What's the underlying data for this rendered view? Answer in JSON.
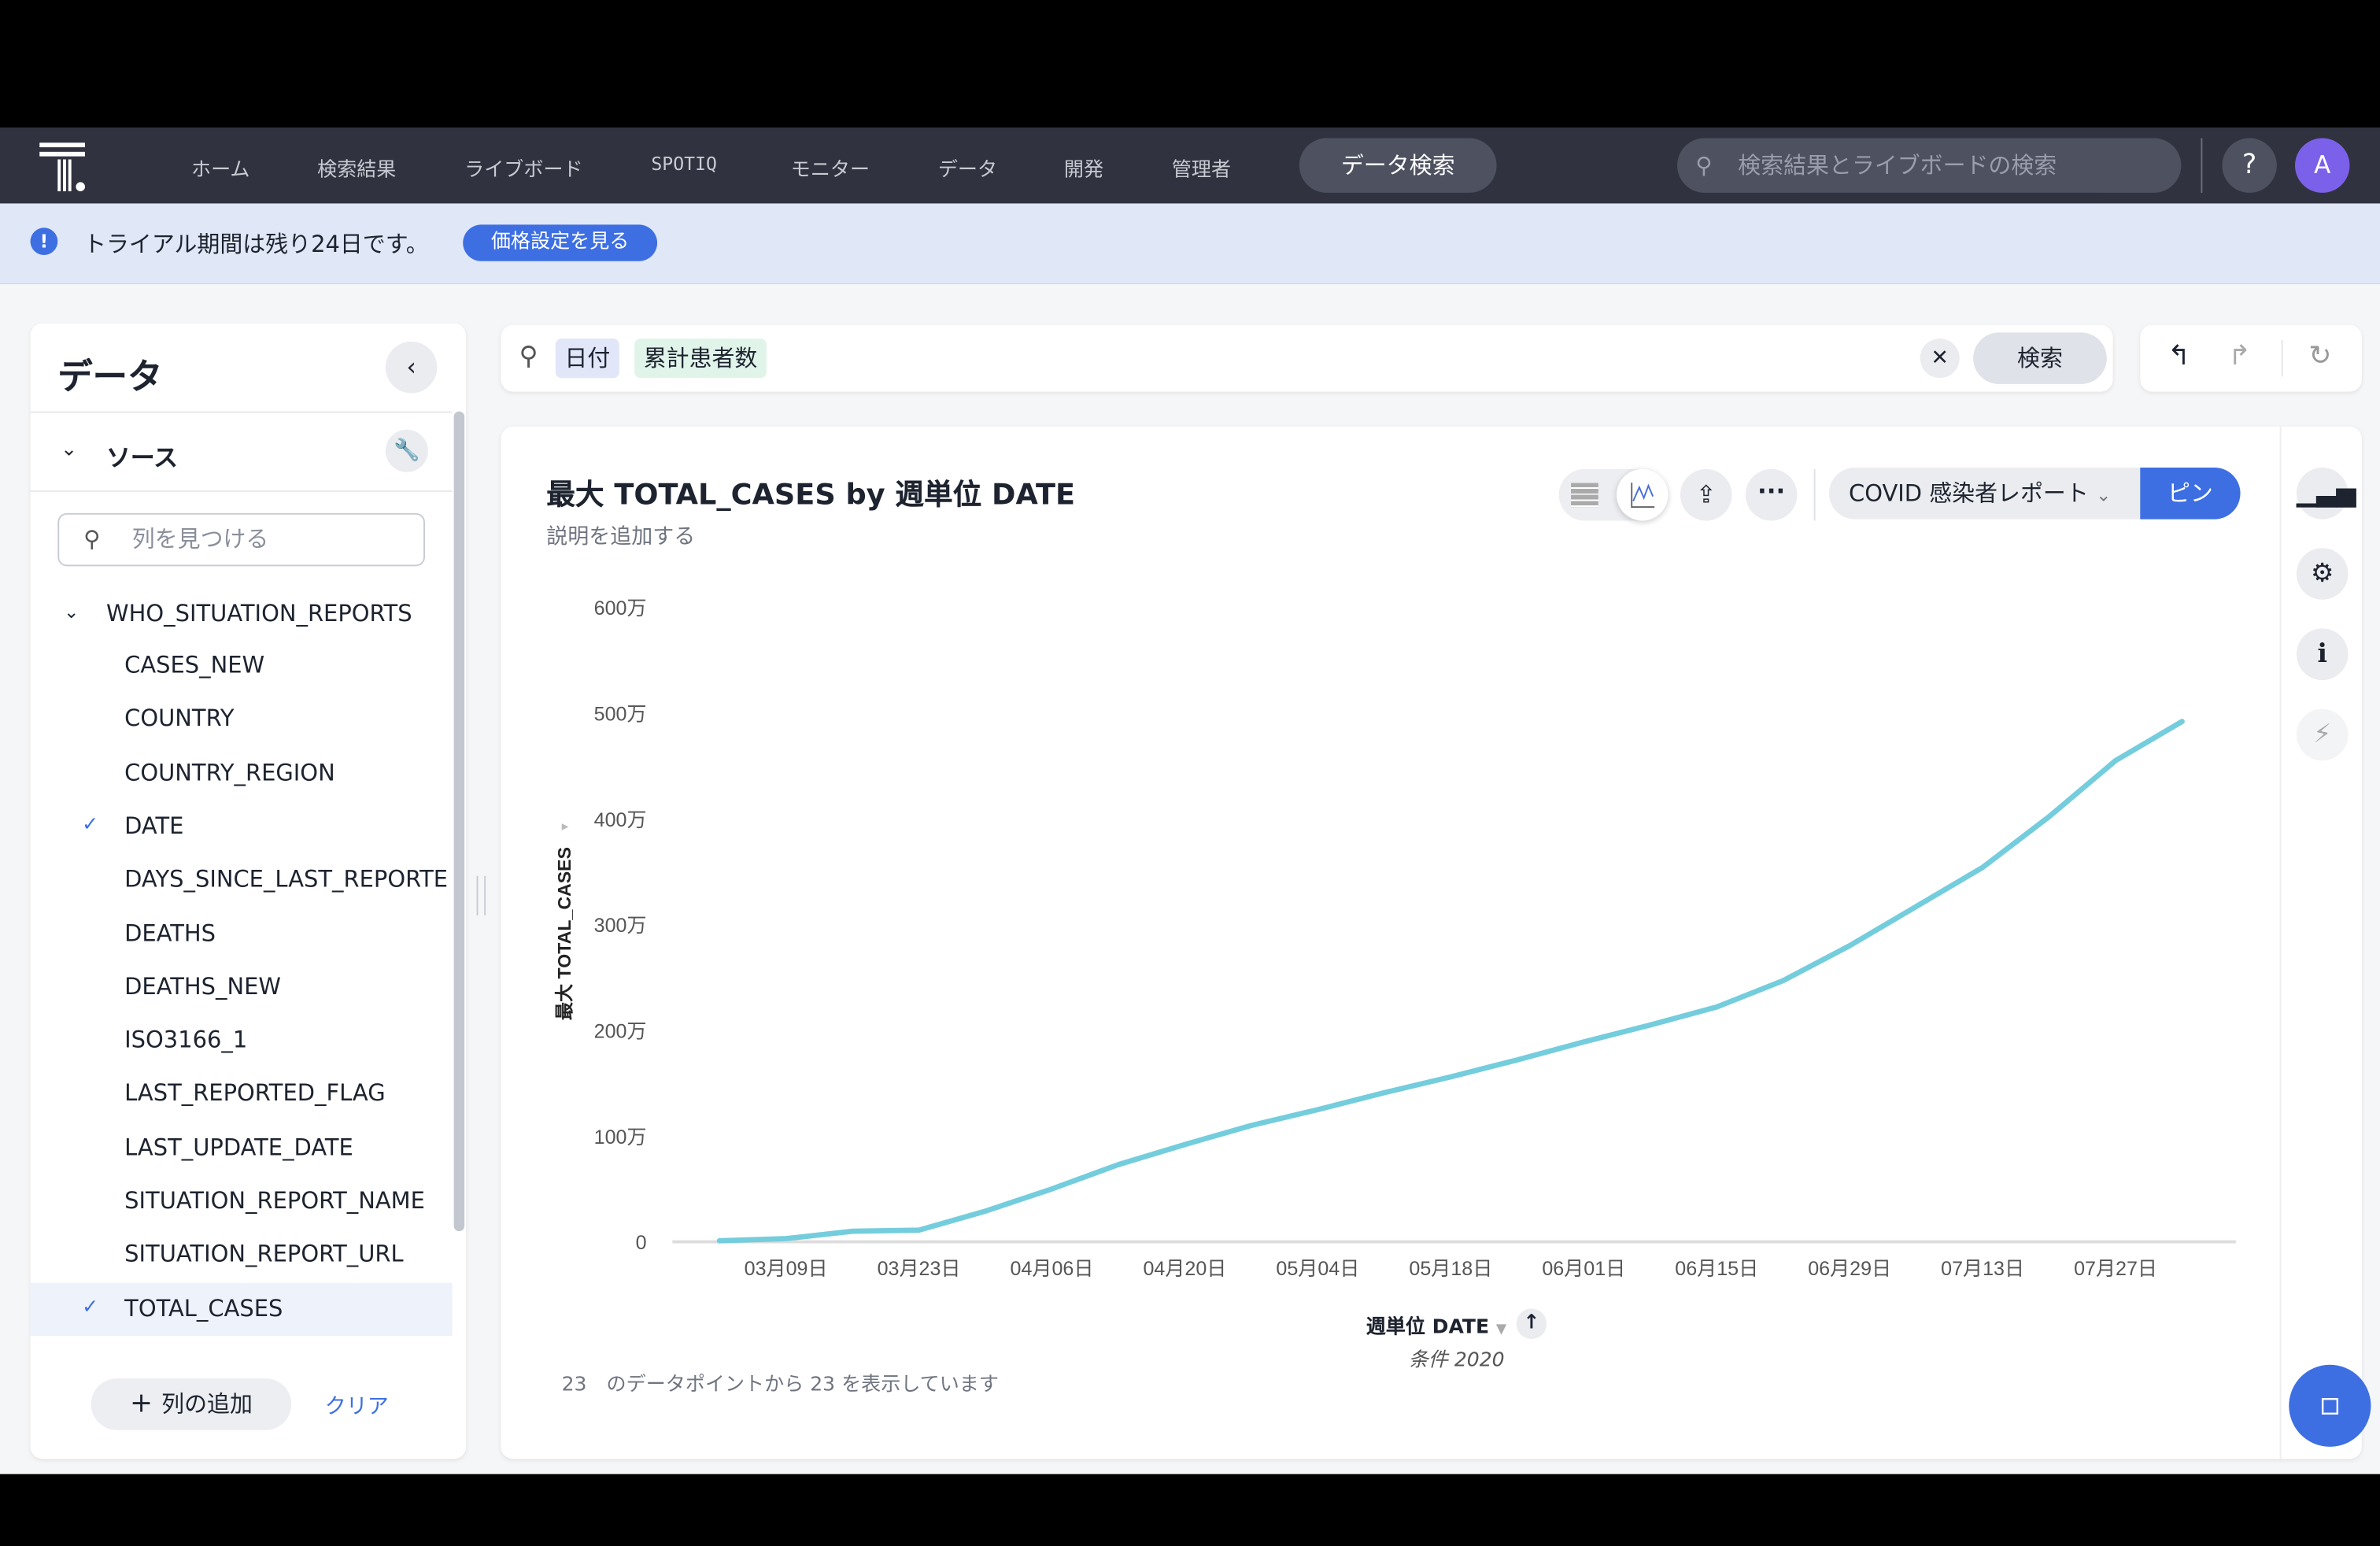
{
  "nav": {
    "items": [
      "ホーム",
      "検索結果",
      "ライブボード",
      "SPOTIQ",
      "モニター",
      "データ",
      "開発",
      "管理者"
    ],
    "data_search": "データ検索",
    "search_placeholder": "検索結果とライブボードの検索",
    "help": "?",
    "avatar": "A"
  },
  "banner": {
    "text": "トライアル期間は残り24日です。",
    "button": "価格設定を見る",
    "icon": "!"
  },
  "sidebar": {
    "title": "データ",
    "section": "ソース",
    "find_placeholder": "列を見つける",
    "table": "WHO_SITUATION_REPORTS",
    "columns": [
      {
        "name": "CASES_NEW",
        "checked": false
      },
      {
        "name": "COUNTRY",
        "checked": false
      },
      {
        "name": "COUNTRY_REGION",
        "checked": false
      },
      {
        "name": "DATE",
        "checked": true
      },
      {
        "name": "DAYS_SINCE_LAST_REPORTE",
        "checked": false
      },
      {
        "name": "DEATHS",
        "checked": false
      },
      {
        "name": "DEATHS_NEW",
        "checked": false
      },
      {
        "name": "ISO3166_1",
        "checked": false
      },
      {
        "name": "LAST_REPORTED_FLAG",
        "checked": false
      },
      {
        "name": "LAST_UPDATE_DATE",
        "checked": false
      },
      {
        "name": "SITUATION_REPORT_NAME",
        "checked": false
      },
      {
        "name": "SITUATION_REPORT_URL",
        "checked": false
      },
      {
        "name": "TOTAL_CASES",
        "checked": true
      }
    ],
    "add_column": "列の追加",
    "clear": "クリア"
  },
  "search": {
    "tokens": [
      "日付",
      "累計患者数"
    ],
    "button": "検索"
  },
  "chart_panel": {
    "title": "最大 TOTAL_CASES by 週単位 DATE",
    "description": "説明を追加する",
    "report": "COVID 感染者レポート",
    "pin": "ピン",
    "x_title": "週単位 DATE",
    "x_filter": "条件 2020",
    "count_text": "23　のデータポイントから 23 を表示しています"
  },
  "colors": {
    "line": "#74cddc",
    "accent": "#3d6fe3",
    "nav": "#30333f"
  },
  "chart_data": {
    "type": "line",
    "title": "最大 TOTAL_CASES by 週単位 DATE",
    "xlabel": "週単位 DATE",
    "ylabel": "最大 TOTAL_CASES",
    "ylim": [
      0,
      6000000
    ],
    "yticks": [
      0,
      1000000,
      2000000,
      3000000,
      4000000,
      5000000,
      6000000
    ],
    "ytick_labels": [
      "0",
      "100万",
      "200万",
      "300万",
      "400万",
      "500万",
      "600万"
    ],
    "xtick_labels": [
      "03月09日",
      "03月23日",
      "04月06日",
      "04月20日",
      "05月04日",
      "05月18日",
      "06月01日",
      "06月15日",
      "06月29日",
      "07月13日",
      "07月27日"
    ],
    "grid": false,
    "x": [
      "2020-03-02",
      "2020-03-09",
      "2020-03-16",
      "2020-03-23",
      "2020-03-30",
      "2020-04-06",
      "2020-04-13",
      "2020-04-20",
      "2020-04-27",
      "2020-05-04",
      "2020-05-11",
      "2020-05-18",
      "2020-05-25",
      "2020-06-01",
      "2020-06-08",
      "2020-06-15",
      "2020-06-22",
      "2020-06-29",
      "2020-07-06",
      "2020-07-13",
      "2020-07-20",
      "2020-07-27",
      "2020-08-03"
    ],
    "values": [
      10000,
      30000,
      100000,
      110000,
      290000,
      500000,
      730000,
      920000,
      1100000,
      1250000,
      1410000,
      1560000,
      1720000,
      1890000,
      2050000,
      2220000,
      2470000,
      2800000,
      3170000,
      3540000,
      4020000,
      4550000,
      4920000
    ]
  }
}
